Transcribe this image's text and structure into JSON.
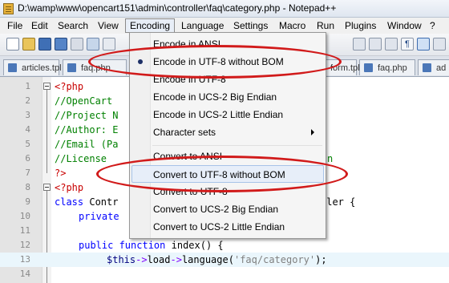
{
  "window": {
    "title": "D:\\wamp\\www\\opencart151\\admin\\controller\\faq\\category.php - Notepad++"
  },
  "menubar": {
    "items": [
      {
        "label": "File",
        "name": "menu-file"
      },
      {
        "label": "Edit",
        "name": "menu-edit"
      },
      {
        "label": "Search",
        "name": "menu-search"
      },
      {
        "label": "View",
        "name": "menu-view"
      },
      {
        "label": "Encoding",
        "name": "menu-encoding"
      },
      {
        "label": "Language",
        "name": "menu-language"
      },
      {
        "label": "Settings",
        "name": "menu-settings"
      },
      {
        "label": "Macro",
        "name": "menu-macro"
      },
      {
        "label": "Run",
        "name": "menu-run"
      },
      {
        "label": "Plugins",
        "name": "menu-plugins"
      },
      {
        "label": "Window",
        "name": "menu-window"
      },
      {
        "label": "?",
        "name": "menu-help"
      }
    ]
  },
  "tabs": [
    {
      "label": "articles.tpl"
    },
    {
      "label": "faq.php"
    },
    {
      "label": "form.tpl"
    },
    {
      "label": "faq.php"
    },
    {
      "label": "ad"
    }
  ],
  "encoding_menu": {
    "items": [
      {
        "label": "Encode in ANSI",
        "checked": false
      },
      {
        "label": "Encode in UTF-8 without BOM",
        "checked": true
      },
      {
        "label": "Encode in UTF-8",
        "checked": false
      },
      {
        "label": "Encode in UCS-2 Big Endian",
        "checked": false
      },
      {
        "label": "Encode in UCS-2 Little Endian",
        "checked": false
      },
      {
        "label": "Character sets",
        "submenu": true
      },
      {
        "label": "Convert to ANSI"
      },
      {
        "label": "Convert to UTF-8 without BOM",
        "hover": true
      },
      {
        "label": "Convert to UTF-8"
      },
      {
        "label": "Convert to UCS-2 Big Endian"
      },
      {
        "label": "Convert to UCS-2 Little Endian"
      }
    ]
  },
  "annotation_color": "#d11a1a",
  "editor": {
    "line_numbers": [
      "1",
      "2",
      "3",
      "4",
      "5",
      "6",
      "7",
      "8",
      "9",
      "10",
      "11",
      "12",
      "13",
      "14"
    ],
    "lines": {
      "l1": "<?php",
      "l2": "//OpenCart",
      "l3": "//Project N",
      "l4": "//Author: E",
      "l5": "//Email (Pa",
      "l6": "//License",
      "l6b": "n",
      "l7": "?>",
      "l8": "<?php",
      "l9a": "class",
      "l9b": " Contr",
      "l9c": "ller {",
      "l10": "private",
      "l12a": "public",
      "l12b": " function",
      "l12c": " index() {",
      "l13a": "$this",
      "l13b": "->",
      "l13c": "load",
      "l13d": "->",
      "l13e": "language(",
      "l13f": "'faq/category'",
      "l13g": ");"
    }
  }
}
